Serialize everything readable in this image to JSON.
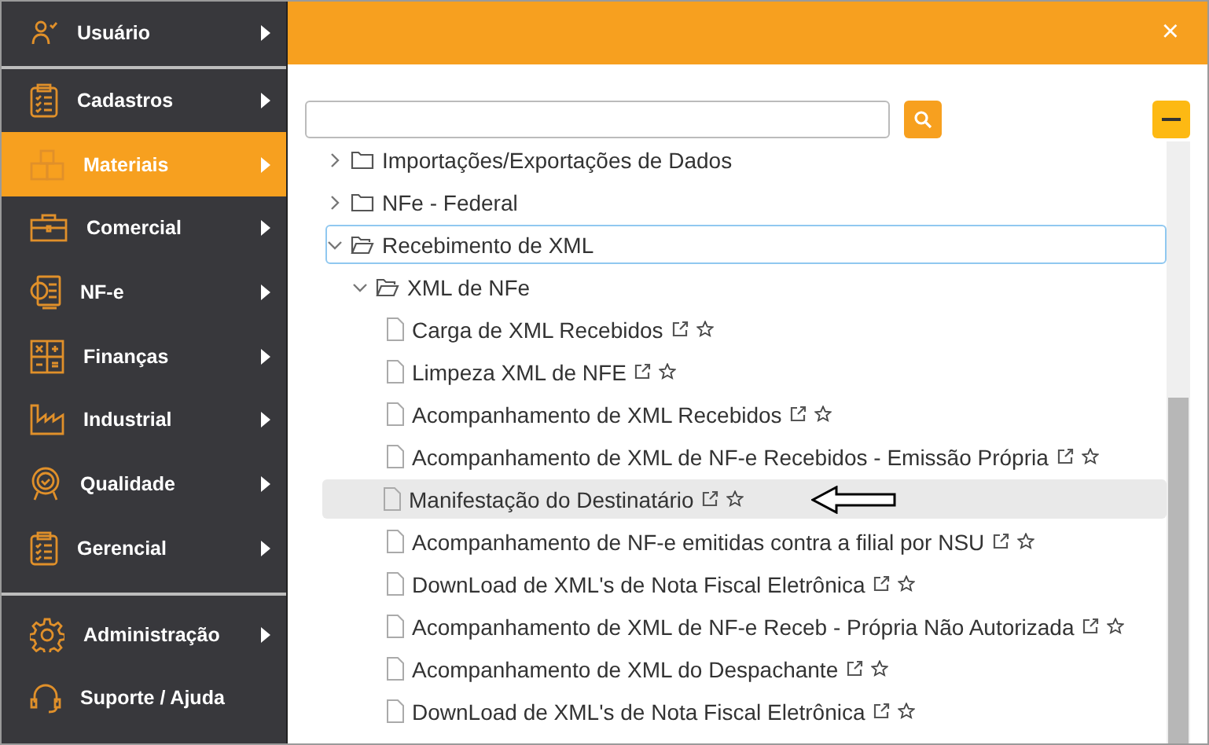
{
  "sidebar": {
    "groups": [
      [
        {
          "label": "Usuário",
          "kind": "user",
          "arrow": true,
          "selected": false
        }
      ],
      [
        {
          "label": "Cadastros",
          "kind": "clipboard",
          "arrow": true,
          "selected": false
        },
        {
          "label": "Materiais",
          "kind": "boxes",
          "arrow": true,
          "selected": true
        },
        {
          "label": "Comercial",
          "kind": "briefcase",
          "arrow": true,
          "selected": false
        },
        {
          "label": "NF-e",
          "kind": "invoice",
          "arrow": true,
          "selected": false
        },
        {
          "label": "Finanças",
          "kind": "calculator",
          "arrow": true,
          "selected": false
        },
        {
          "label": "Industrial",
          "kind": "factory",
          "arrow": true,
          "selected": false
        },
        {
          "label": "Qualidade",
          "kind": "badge",
          "arrow": true,
          "selected": false
        },
        {
          "label": "Gerencial",
          "kind": "clipboard",
          "arrow": true,
          "selected": false
        }
      ],
      [
        {
          "label": "Administração",
          "kind": "gear",
          "arrow": true,
          "selected": false
        },
        {
          "label": "Suporte / Ajuda",
          "kind": "headset",
          "arrow": false,
          "selected": false
        }
      ]
    ]
  },
  "dialog": {
    "close": "×",
    "tree": [
      {
        "label": "Importações/Exportações de Dados",
        "kind": "folder",
        "expanded": false,
        "focused": false,
        "highlighted": false
      },
      {
        "label": "NFe - Federal",
        "kind": "folder",
        "expanded": false,
        "focused": false,
        "highlighted": false
      },
      {
        "label": "Recebimento de XML",
        "kind": "folder",
        "expanded": true,
        "focused": true,
        "highlighted": false,
        "children": [
          {
            "label": "XML de NFe",
            "kind": "folder",
            "expanded": true,
            "focused": false,
            "highlighted": false,
            "children": [
              {
                "label": "Carga de XML Recebidos",
                "kind": "page",
                "focused": false,
                "highlighted": false
              },
              {
                "label": "Limpeza XML de NFE",
                "kind": "page",
                "focused": false,
                "highlighted": false
              },
              {
                "label": "Acompanhamento de XML Recebidos",
                "kind": "page",
                "focused": false,
                "highlighted": false
              },
              {
                "label": "Acompanhamento de XML de NF-e Recebidos - Emissão Própria",
                "kind": "page",
                "focused": false,
                "highlighted": false
              },
              {
                "label": "Manifestação do Destinatário",
                "kind": "page",
                "focused": false,
                "highlighted": true
              },
              {
                "label": "Acompanhamento de NF-e emitidas contra a filial por NSU",
                "kind": "page",
                "focused": false,
                "highlighted": false
              },
              {
                "label": "DownLoad de XML's de Nota Fiscal Eletrônica",
                "kind": "page",
                "focused": false,
                "highlighted": false
              },
              {
                "label": "Acompanhamento de XML de NF-e Receb - Própria Não Autorizada",
                "kind": "page",
                "focused": false,
                "highlighted": false
              },
              {
                "label": "Acompanhamento de XML do Despachante",
                "kind": "page",
                "focused": false,
                "highlighted": false
              },
              {
                "label": "DownLoad de XML's de Nota Fiscal Eletrônica",
                "kind": "page",
                "focused": false,
                "highlighted": false
              }
            ]
          }
        ]
      }
    ]
  }
}
